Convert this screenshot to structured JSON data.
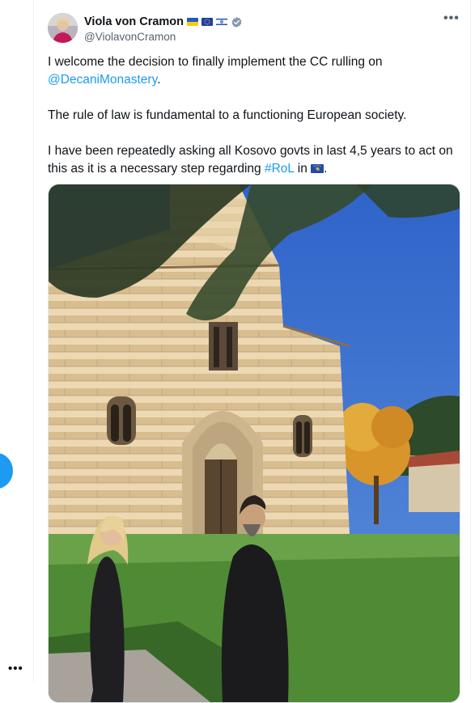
{
  "author": {
    "name": "Viola von Cramon",
    "handle": "@ViolavonCramon",
    "badges": [
      "flag-ukraine-icon",
      "flag-eu-icon",
      "flag-israel-icon",
      "verified-badge-icon"
    ]
  },
  "menu": {
    "more_label": "•••"
  },
  "sidebar": {
    "more_label": "•••"
  },
  "tweet": {
    "p1_text": "I welcome the decision to finally implement the CC rulling on",
    "p1_mention": "@DecaniMonastery",
    "p1_end": ".",
    "p2": "The rule of law is fundamental to a functioning European society.",
    "p3_text": "I have been repeatedly asking all Kosovo govts in last 4,5 years to act on this as it is a necessary step regarding",
    "p3_hashtag": "#RoL",
    "p3_in": "in",
    "p3_end": "."
  },
  "colors": {
    "accent": "#1d9bf0",
    "text": "#0f1419",
    "muted": "#536471",
    "verified": "#829aab"
  },
  "media": {
    "icon": "photo-church-with-two-people"
  }
}
